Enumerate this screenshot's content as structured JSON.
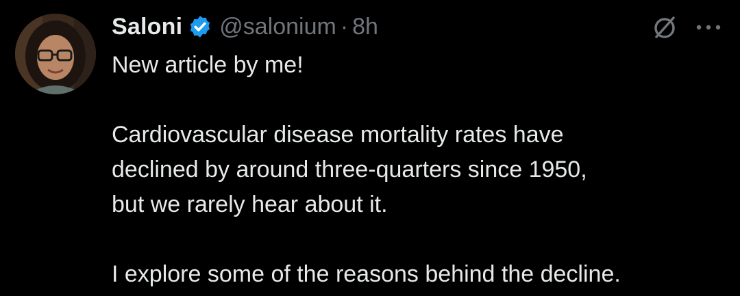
{
  "colors": {
    "background": "#000000",
    "primary_text": "#e7e9ea",
    "secondary_text": "#71767b",
    "verified_badge": "#1d9bf0"
  },
  "author": {
    "display_name": "Saloni",
    "handle": "@salonium",
    "separator": "·",
    "time": "8h",
    "verified": true
  },
  "icons": {
    "avatar": "avatar",
    "verified": "verified-badge-icon",
    "grok": "grok-icon",
    "more": "more-options-icon"
  },
  "tweet": {
    "line1": "New article by me!",
    "para2_line1": "Cardiovascular disease mortality rates have",
    "para2_line2": "declined by around three-quarters since 1950,",
    "para2_line3": "but we rarely hear about it.",
    "para3_line1": "I explore some of the reasons behind the decline."
  }
}
